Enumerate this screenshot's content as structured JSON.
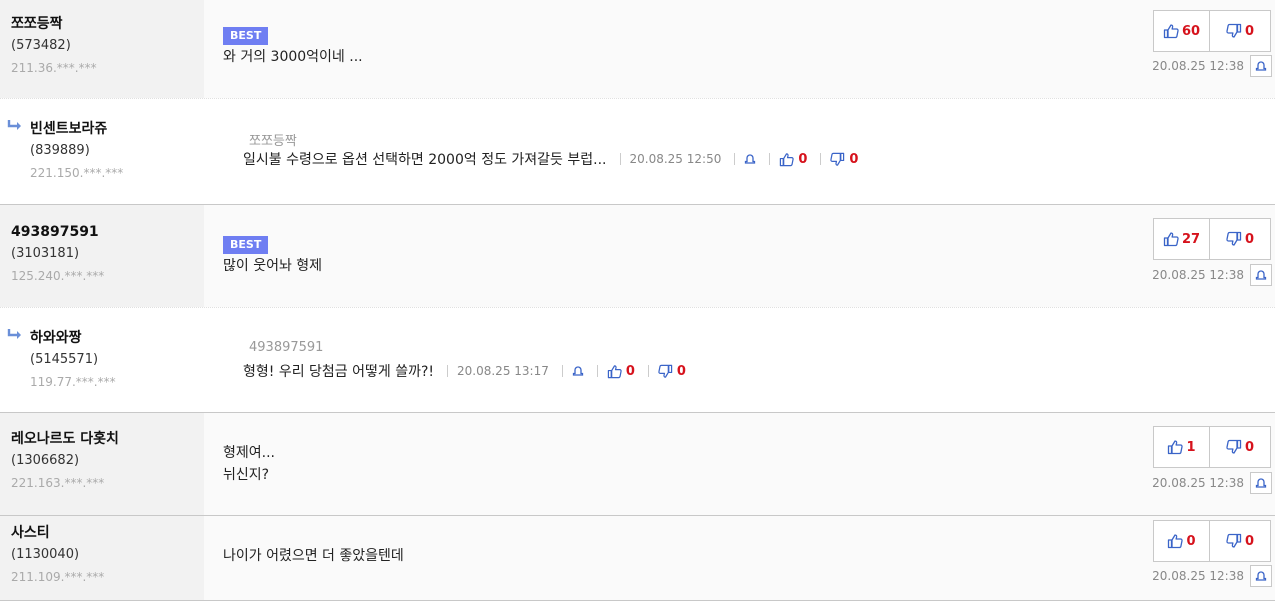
{
  "comments": [
    {
      "nick": "쪼쪼등짝",
      "uid": "(573482)",
      "ip": "211.36.***.***",
      "best": "BEST",
      "text": "와 거의 3000억이네 ...",
      "up": "60",
      "down": "0",
      "date": "20.08.25 12:38"
    },
    {
      "nick": "빈센트보라쥬",
      "uid": "(839889)",
      "ip": "221.150.***.***",
      "quoted": "쪼쪼등짝",
      "text": "일시불 수령으로 옵션 선택하면 2000억 정도 가져갈듯 부럽...",
      "date": "20.08.25 12:50",
      "up": "0",
      "down": "0"
    },
    {
      "nick": "493897591",
      "uid": "(3103181)",
      "ip": "125.240.***.***",
      "best": "BEST",
      "text": "많이 웃어놔 형제",
      "up": "27",
      "down": "0",
      "date": "20.08.25 12:38"
    },
    {
      "nick": "하와와짱",
      "uid": "(5145571)",
      "ip": "119.77.***.***",
      "quoted": "493897591",
      "text": "형형! 우리 당첨금 어떻게 쓸까?!",
      "date": "20.08.25 13:17",
      "up": "0",
      "down": "0"
    },
    {
      "nick": "레오나르도 다홋치",
      "uid": "(1306682)",
      "ip": "221.163.***.***",
      "text": "형제여...\n뉘신지?",
      "up": "1",
      "down": "0",
      "date": "20.08.25 12:38"
    },
    {
      "nick": "사스티",
      "uid": "(1130040)",
      "ip": "211.109.***.***",
      "text": "나이가 어렸으면 더 좋았을텐데",
      "up": "0",
      "down": "0",
      "date": "20.08.25 12:38"
    }
  ],
  "colors": {
    "accent": "#6f7ef2",
    "count": "#d6121c",
    "icon": "#3a64c8"
  },
  "icons": {
    "up": "thumbs-up-icon",
    "down": "thumbs-down-icon",
    "report": "bell-icon",
    "reply": "reply-arrow-icon"
  }
}
